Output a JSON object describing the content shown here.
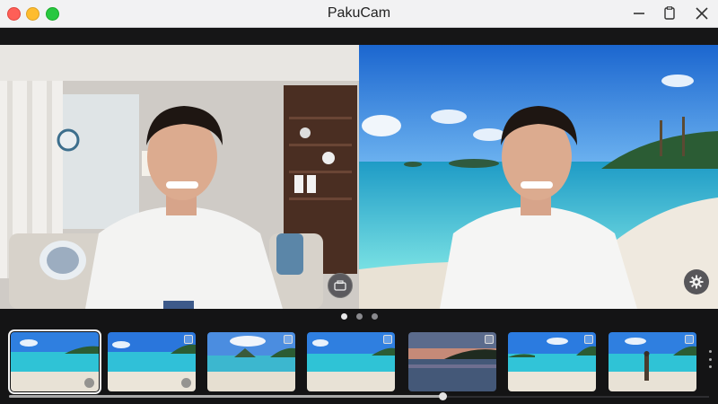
{
  "window": {
    "title": "PakuCam"
  },
  "titlebar_icons": [
    "minimize-icon",
    "restore-icon",
    "close-icon"
  ],
  "preview": {
    "left": {
      "scene": "original-room"
    },
    "right": {
      "scene": "beach-background"
    }
  },
  "controls": {
    "camera_icon": "camera-switch-icon",
    "settings_icon": "gear-icon"
  },
  "pager": {
    "count": 3,
    "active": 0
  },
  "backgrounds": [
    {
      "name": "beach-1",
      "selected": true
    },
    {
      "name": "beach-2",
      "selected": false
    },
    {
      "name": "beach-3",
      "selected": false
    },
    {
      "name": "beach-4",
      "selected": false
    },
    {
      "name": "sunset-water",
      "selected": false
    },
    {
      "name": "beach-5",
      "selected": false
    },
    {
      "name": "beach-person",
      "selected": false
    }
  ],
  "scroll": {
    "position_fraction": 0.62
  },
  "colors": {
    "sky": "#2f7fe0",
    "sea": "#2fc3d6",
    "sand": "#e8e2d6",
    "accent": "#f4f4f4"
  }
}
